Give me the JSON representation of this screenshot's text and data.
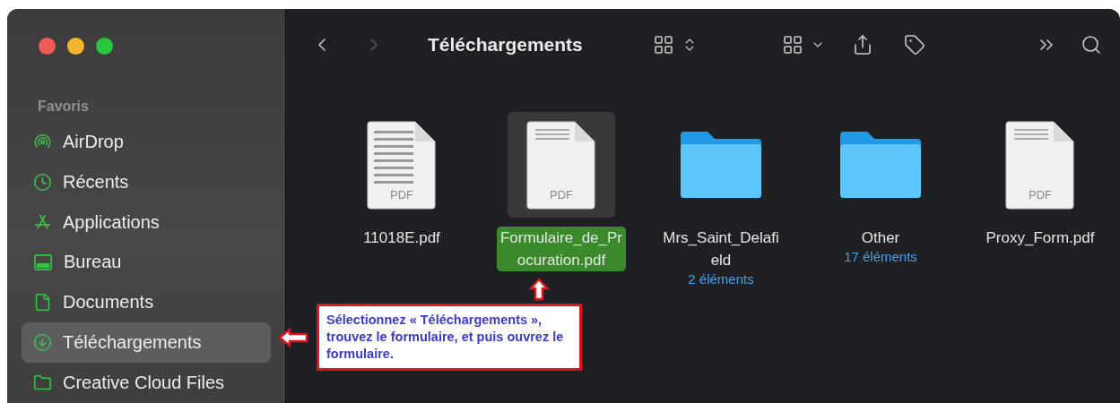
{
  "sidebar": {
    "section": "Favoris",
    "items": [
      {
        "label": "AirDrop",
        "kind": "airdrop",
        "selected": false
      },
      {
        "label": "Récents",
        "kind": "clock",
        "selected": false
      },
      {
        "label": "Applications",
        "kind": "apps",
        "selected": false
      },
      {
        "label": "Bureau",
        "kind": "desktop",
        "selected": false
      },
      {
        "label": "Documents",
        "kind": "document",
        "selected": false
      },
      {
        "label": "Téléchargements",
        "kind": "download",
        "selected": true
      },
      {
        "label": "Creative Cloud Files",
        "kind": "folder",
        "selected": false
      }
    ]
  },
  "toolbar": {
    "title": "Téléchargements"
  },
  "files": [
    {
      "kind": "pdf",
      "name_lines": [
        "11018E.pdf"
      ],
      "badge": "PDF",
      "selected": false
    },
    {
      "kind": "pdf",
      "name_lines": [
        "Formulaire_de_Pr",
        "ocuration.pdf"
      ],
      "badge": "PDF",
      "selected": true
    },
    {
      "kind": "folder",
      "name_lines": [
        "Mrs_Saint_Delafi",
        "eld"
      ],
      "count": "2 éléments",
      "selected": false
    },
    {
      "kind": "folder",
      "name_lines": [
        "Other"
      ],
      "count": "17 éléments",
      "selected": false
    },
    {
      "kind": "pdf",
      "name_lines": [
        "Proxy_Form.pdf"
      ],
      "badge": "PDF",
      "selected": false
    }
  ],
  "callout": {
    "text": "Sélectionnez « Téléchargements », trouvez le formulaire, et puis ouvrez le formulaire."
  }
}
